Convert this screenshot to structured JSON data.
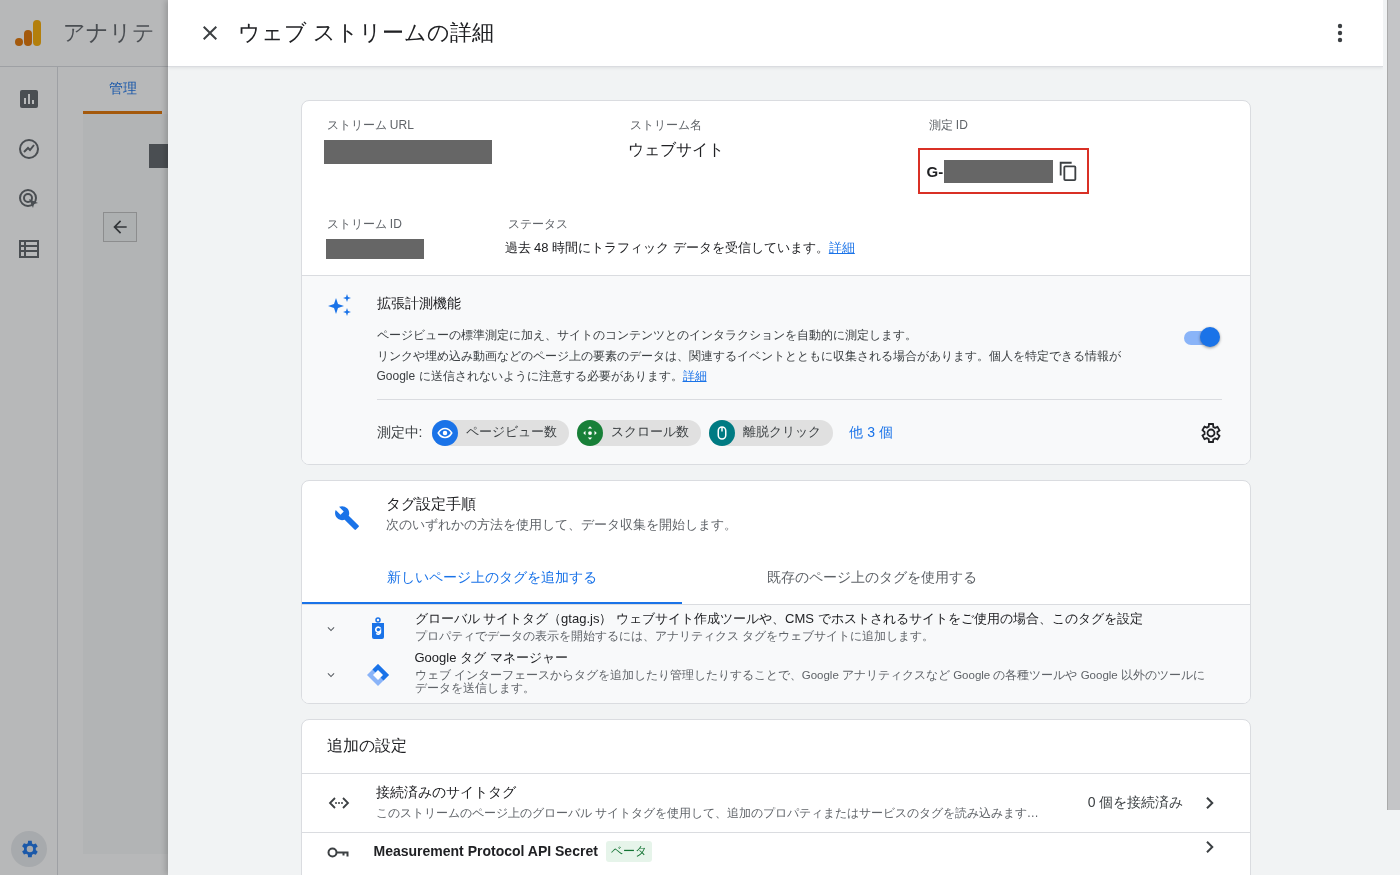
{
  "app": {
    "title": "アナリテ",
    "nav_tab": "管理"
  },
  "panel": {
    "title": "ウェブ ストリームの詳細"
  },
  "stream": {
    "url_label": "ストリーム URL",
    "name_label": "ストリーム名",
    "name_value": "ウェブサイト",
    "measurement_id_label": "測定 ID",
    "measurement_id_prefix": "G-",
    "measurement_id_highlighted": true,
    "id_label": "ストリーム ID",
    "status_label": "ステータス",
    "status_text": "過去 48 時間にトラフィック データを受信しています。",
    "status_link": "詳細"
  },
  "enhanced": {
    "title": "拡張計測機能",
    "description_lines": [
      "ページビューの標準測定に加え、サイトのコンテンツとのインタラクションを自動的に測定します。",
      "リンクや埋め込み動画などのページ上の要素のデータは、関連するイベントとともに収集される場合があります。個人を特定できる情報がGoogle に送信されないように注意する必要があります。"
    ],
    "link": "詳細",
    "on": true,
    "measuring_label": "測定中:",
    "chips": [
      {
        "label": "ページビュー数",
        "kind": "eye",
        "color": "#1a73e8"
      },
      {
        "label": "スクロール数",
        "kind": "scroll",
        "color": "#188038"
      },
      {
        "label": "離脱クリック",
        "kind": "mouse",
        "color": "#007b83"
      }
    ],
    "more": "他 3 個"
  },
  "tag_setup": {
    "title": "タグ設定手順",
    "subtitle": "次のいずれかの方法を使用して、データ収集を開始します。",
    "tabs": [
      {
        "label": "新しいページ上のタグを追加する",
        "selected": true
      },
      {
        "label": "既存のページ上のタグを使用する",
        "selected": false
      }
    ],
    "options": [
      {
        "kind": "gtag",
        "title": "グローバル サイトタグ（gtag.js） ウェブサイト作成ツールや、CMS でホストされるサイトをご使用の場合、このタグを設定",
        "description": "プロパティでデータの表示を開始するには、アナリティクス タグをウェブサイトに追加します。",
        "expanded": false
      },
      {
        "kind": "gtm",
        "title": "Google タグ マネージャー",
        "description": "ウェブ インターフェースからタグを追加したり管理したりすることで、Google アナリティクスなど Google の各種ツールや Google 以外のツールにデータを送信します。",
        "expanded": false
      }
    ]
  },
  "additional": {
    "title": "追加の設定",
    "rows": [
      {
        "kind": "code",
        "title": "接続済みのサイトタグ",
        "description": "このストリームのページ上のグローバル サイトタグを使用して、追加のプロパティまたはサービスのタグを読み込みます…",
        "value": "0 個を接続済み"
      },
      {
        "kind": "key",
        "title": "Measurement Protocol API Secret",
        "badge": "ベータ"
      }
    ]
  }
}
